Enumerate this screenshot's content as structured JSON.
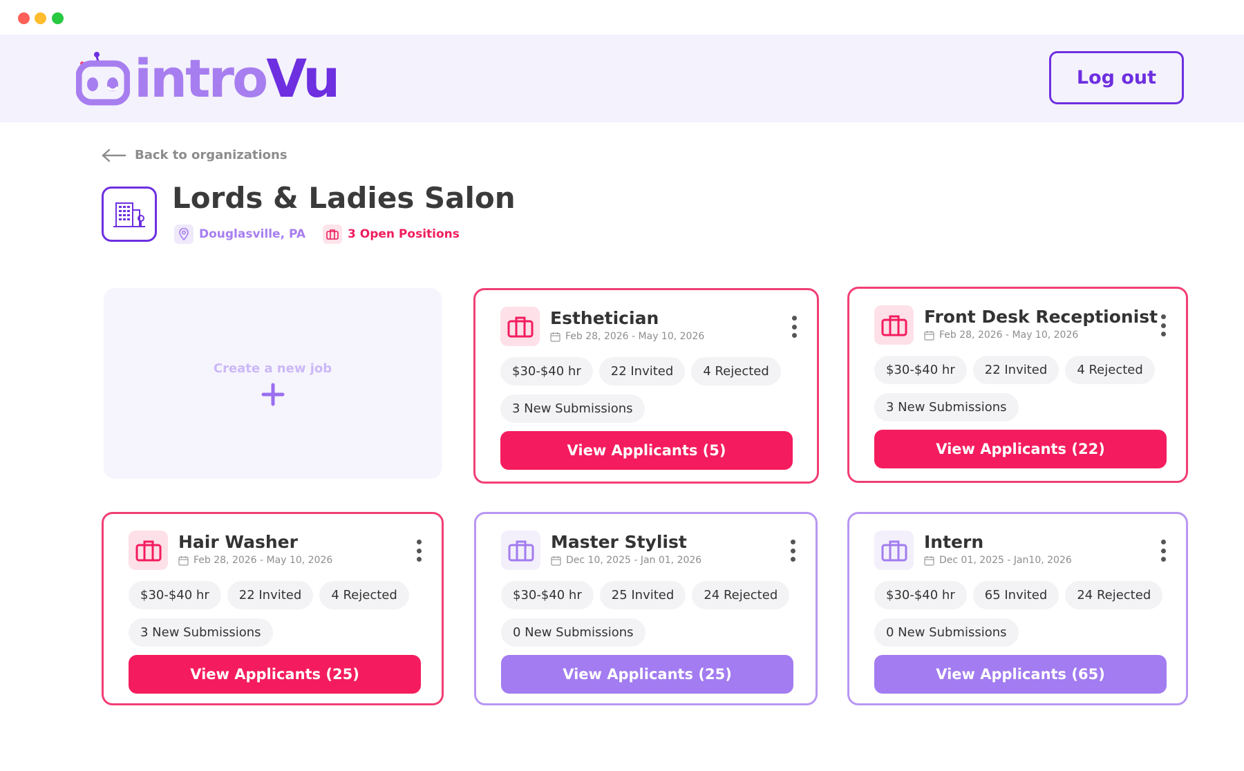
{
  "app": {
    "logo_text_intro": "intro",
    "logo_text_vu": "Vu",
    "logout_label": "Log out"
  },
  "nav": {
    "back_label": "Back to organizations"
  },
  "organization": {
    "name": "Lords & Ladies Salon",
    "location": "Douglasville, PA",
    "open_positions": "3 Open Positions"
  },
  "create_job": {
    "label": "Create a new job"
  },
  "jobs": [
    {
      "title": "Esthetician",
      "dates": "Feb 28, 2026 -  May 10, 2026",
      "rate": "$30-$40 hr",
      "invited": "22 Invited",
      "rejected": "4 Rejected",
      "submissions": "3 New Submissions",
      "button": "View Applicants (5)",
      "accent": "#f41c5e"
    },
    {
      "title": "Front Desk Receptionist",
      "dates": "Feb 28, 2026 -  May 10, 2026",
      "rate": "$30-$40 hr",
      "invited": "22 Invited",
      "rejected": "4 Rejected",
      "submissions": "3 New Submissions",
      "button": "View Applicants (22)",
      "accent": "#f41c5e"
    },
    {
      "title": "Hair Washer",
      "dates": "Feb 28, 2026 -  May 10, 2026",
      "rate": "$30-$40 hr",
      "invited": "22 Invited",
      "rejected": "4 Rejected",
      "submissions": "3 New Submissions",
      "button": "View Applicants (25)",
      "accent": "#f41c5e"
    },
    {
      "title": "Master Stylist",
      "dates": "Dec 10, 2025 -  Jan 01, 2026",
      "rate": "$30-$40 hr",
      "invited": "25 Invited",
      "rejected": "24 Rejected",
      "submissions": "0 New Submissions",
      "button": "View Applicants (25)",
      "accent": "#a27cf0"
    },
    {
      "title": "Intern",
      "dates": "Dec 01, 2025 -  Jan10, 2026",
      "rate": "$30-$40 hr",
      "invited": "65 Invited",
      "rejected": "24 Rejected",
      "submissions": "0 New Submissions",
      "button": "View Applicants (65)",
      "accent": "#a27cf0"
    }
  ],
  "icons": {
    "window_close": "close-dot",
    "window_minimize": "minimize-dot",
    "window_maximize": "maximize-dot",
    "back": "arrow-left-icon",
    "org": "building-icon",
    "location": "map-pin-icon",
    "positions": "briefcase-icon",
    "dates": "calendar-icon",
    "menu": "more-vertical-icon",
    "create": "plus-icon"
  },
  "colors": {
    "brand_primary": "#6d2fe0",
    "brand_light": "#a77ef0",
    "accent_active": "#f41c5e",
    "accent_inactive": "#a27cf0",
    "header_bg": "#f4f2fc"
  }
}
